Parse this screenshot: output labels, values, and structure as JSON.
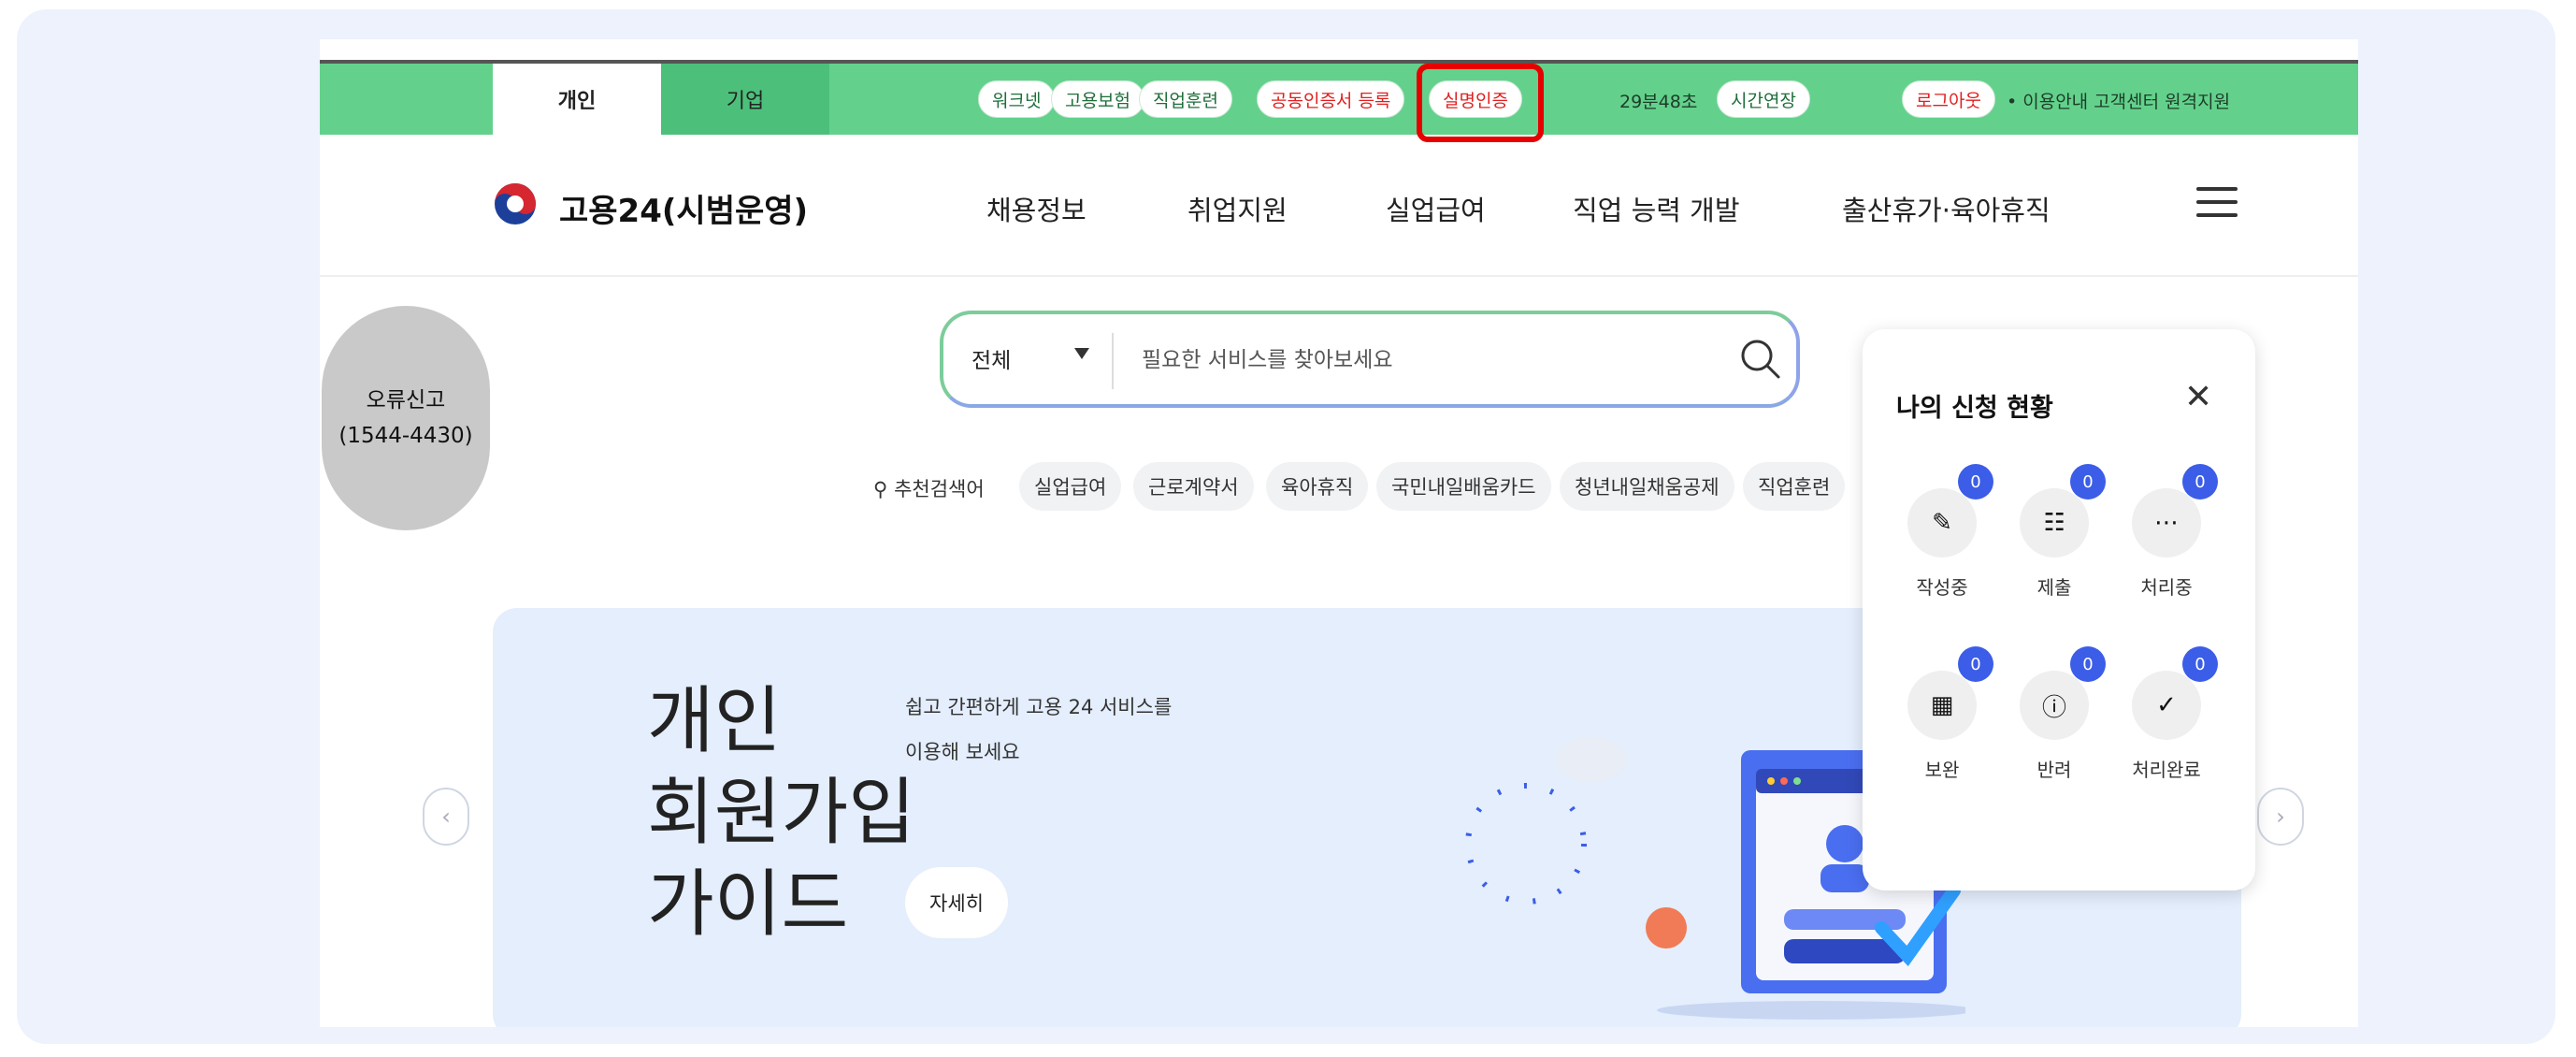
{
  "topbar": {
    "tabs": [
      {
        "label": "개인",
        "active": true
      },
      {
        "label": "기업",
        "active": false
      }
    ],
    "pills": [
      "워크넷",
      "고용보험",
      "직업훈련"
    ],
    "cert_register": "공동인증서 등록",
    "real_name_cert": "실명인증",
    "timer": "29분48초",
    "extend": "시간연장",
    "logout": "로그아웃",
    "links": "• 이용안내 고객센터 원격지원"
  },
  "nav": {
    "brand": "고용24(시범운영)",
    "items": [
      "채용정보",
      "취업지원",
      "실업급여",
      "직업 능력 개발",
      "출산휴가·육아휴직"
    ]
  },
  "error_report": {
    "line1": "오류신고",
    "line2": "(1544-4430)"
  },
  "search": {
    "category": "전체",
    "placeholder": "필요한 서비스를 찾아보세요",
    "recommended_label": "추천검색어",
    "chips": [
      "실업급여",
      "근로계약서",
      "육아휴직",
      "국민내일배움카드",
      "청년내일채움공제",
      "직업훈련"
    ]
  },
  "banner": {
    "title_lines": [
      "개인",
      "회원가입",
      "가이드"
    ],
    "subtitle_lines": [
      "쉽고 간편하게 고용 24 서비스를",
      "이용해 보세요"
    ],
    "detail_button": "자세히"
  },
  "panel": {
    "title": "나의 신청 현황",
    "items": [
      {
        "label": "작성중",
        "count": "0",
        "icon": "pencil-icon"
      },
      {
        "label": "제출",
        "count": "0",
        "icon": "checklist-icon"
      },
      {
        "label": "처리중",
        "count": "0",
        "icon": "ellipsis-circle-icon"
      },
      {
        "label": "보완",
        "count": "0",
        "icon": "grid-icon"
      },
      {
        "label": "반려",
        "count": "0",
        "icon": "exclamation-circle-icon"
      },
      {
        "label": "처리완료",
        "count": "0",
        "icon": "check-circle-icon"
      }
    ]
  },
  "colors": {
    "topbar": "#63d18c",
    "badge": "#3b5de7",
    "highlight": "#e60000",
    "banner": "#e4eefc"
  }
}
